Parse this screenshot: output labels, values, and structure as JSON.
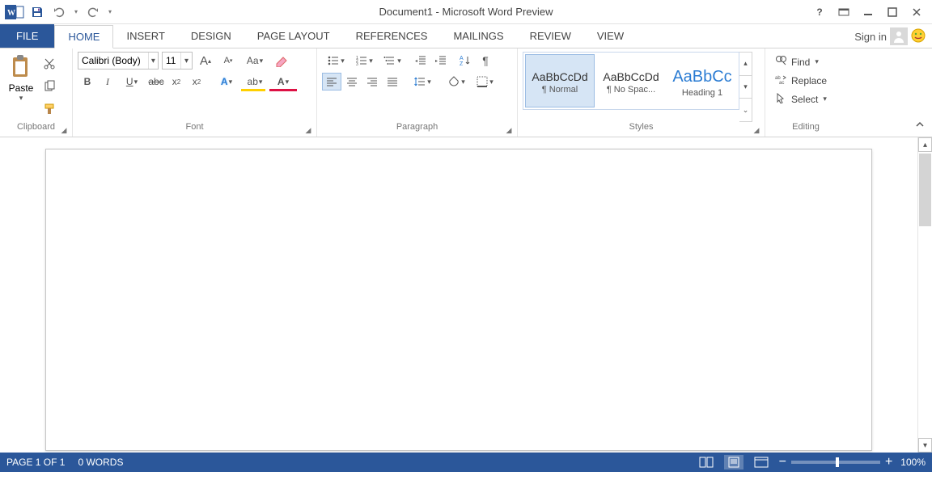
{
  "title": "Document1 - Microsoft Word Preview",
  "signin": "Sign in",
  "file_tab": "FILE",
  "tabs": [
    "HOME",
    "INSERT",
    "DESIGN",
    "PAGE LAYOUT",
    "REFERENCES",
    "MAILINGS",
    "REVIEW",
    "VIEW"
  ],
  "groups": {
    "clipboard": {
      "label": "Clipboard",
      "paste": "Paste"
    },
    "font": {
      "label": "Font",
      "font_name": "Calibri (Body)",
      "font_size": "11"
    },
    "paragraph": {
      "label": "Paragraph"
    },
    "styles": {
      "label": "Styles",
      "items": [
        {
          "preview": "AaBbCcDd",
          "name": "¶ Normal",
          "selected": true,
          "kind": "body"
        },
        {
          "preview": "AaBbCcDd",
          "name": "¶ No Spac...",
          "selected": false,
          "kind": "body"
        },
        {
          "preview": "AaBbCc",
          "name": "Heading 1",
          "selected": false,
          "kind": "h1"
        }
      ]
    },
    "editing": {
      "label": "Editing",
      "find": "Find",
      "replace": "Replace",
      "select": "Select"
    }
  },
  "status": {
    "page": "PAGE 1 OF 1",
    "words": "0 WORDS",
    "zoom": "100%"
  }
}
